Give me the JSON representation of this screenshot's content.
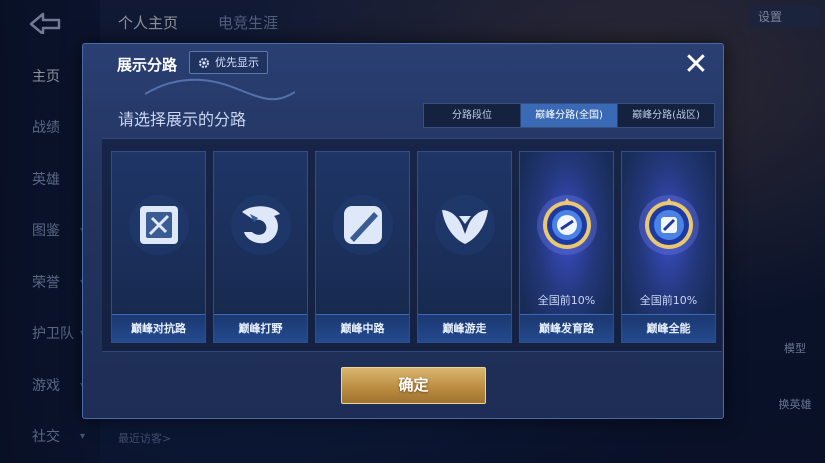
{
  "background": {
    "nav": {
      "items": [
        {
          "label": "主页",
          "active": true,
          "chevron": false
        },
        {
          "label": "战绩",
          "active": false,
          "chevron": false
        },
        {
          "label": "英雄",
          "active": false,
          "chevron": false
        },
        {
          "label": "图鉴",
          "active": false,
          "chevron": true
        },
        {
          "label": "荣誉",
          "active": false,
          "chevron": true
        },
        {
          "label": "护卫队",
          "active": false,
          "chevron": true
        },
        {
          "label": "游戏",
          "active": false,
          "chevron": true
        },
        {
          "label": "社交",
          "active": false,
          "chevron": true
        }
      ]
    },
    "top_tabs": [
      "个人主页",
      "电竞生涯"
    ],
    "settings_label": "设置",
    "right_buttons": [
      "模型",
      "换英雄"
    ],
    "recent_visitors": "最近访客>"
  },
  "dialog": {
    "title": "展示分路",
    "priority_label": "优先显示",
    "close_symbol": "✕",
    "subtitle": "请选择展示的分路",
    "seg_tabs": [
      {
        "label": "分路段位",
        "active": false
      },
      {
        "label": "巅峰分路(全国)",
        "active": true
      },
      {
        "label": "巅峰分路(战区)",
        "active": false
      }
    ],
    "cards": [
      {
        "label": "巅峰对抗路",
        "icon": "clash-lane-icon",
        "rank": "",
        "highlighted": false
      },
      {
        "label": "巅峰打野",
        "icon": "jungle-icon",
        "rank": "",
        "highlighted": false
      },
      {
        "label": "巅峰中路",
        "icon": "mid-lane-icon",
        "rank": "",
        "highlighted": false
      },
      {
        "label": "巅峰游走",
        "icon": "roam-icon",
        "rank": "",
        "highlighted": false
      },
      {
        "label": "巅峰发育路",
        "icon": "farm-lane-badge-icon",
        "rank": "全国前10%",
        "highlighted": true
      },
      {
        "label": "巅峰全能",
        "icon": "all-round-badge-icon",
        "rank": "全国前10%",
        "highlighted": true
      }
    ],
    "confirm_label": "确定"
  },
  "colors": {
    "accent_blue": "#3a6ab6",
    "confirm_gold": "#c99a4a"
  }
}
